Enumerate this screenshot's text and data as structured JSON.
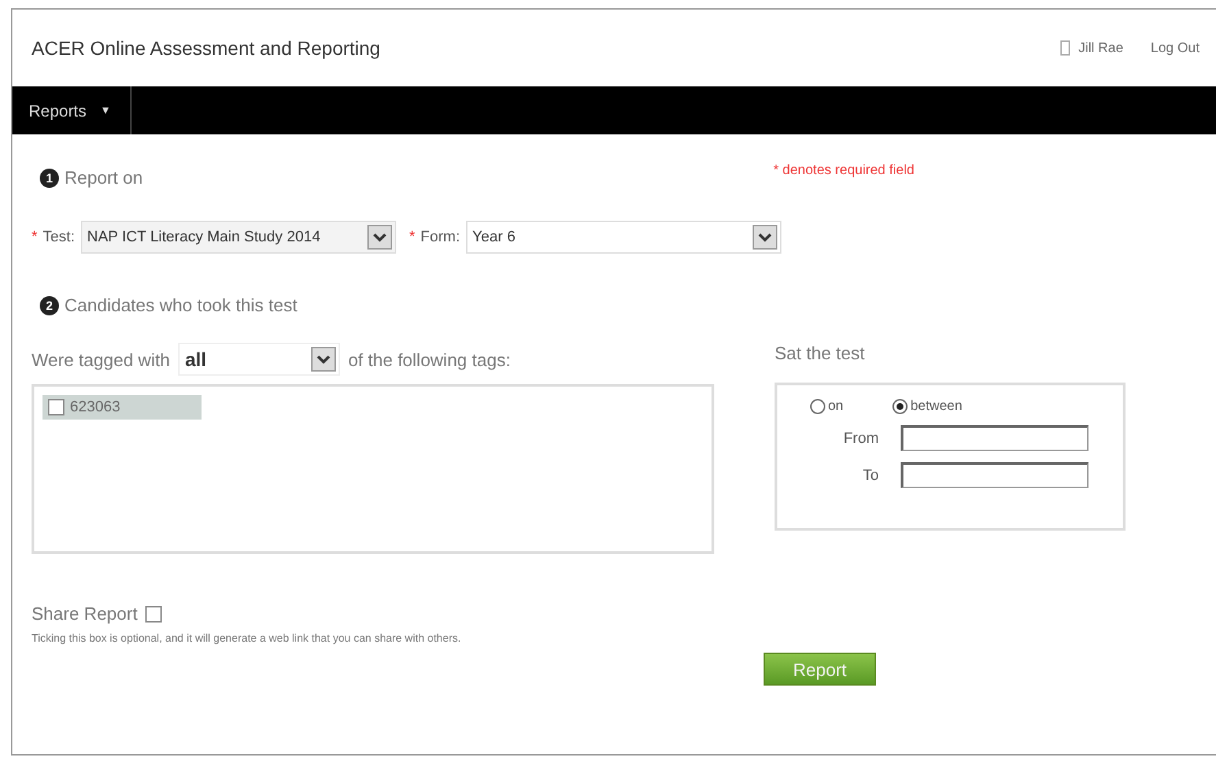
{
  "header": {
    "title": "ACER Online Assessment and Reporting",
    "user": "Jill Rae",
    "logout": "Log Out"
  },
  "nav": {
    "menu": "Reports",
    "caret": "▼"
  },
  "required_note": "* denotes required field",
  "section1": {
    "number": "1",
    "title": "Report on"
  },
  "test": {
    "required": "*",
    "label": "Test:",
    "value": "NAP ICT Literacy Main Study 2014"
  },
  "form": {
    "required": "*",
    "label": "Form:",
    "value": "Year 6"
  },
  "section2": {
    "number": "2",
    "title": "Candidates who took this test"
  },
  "tag_filter": {
    "before": "Were tagged with",
    "value": "all",
    "after": "of the following tags:"
  },
  "tags": [
    {
      "label": "623063",
      "checked": false,
      "selected": true
    }
  ],
  "sat": {
    "title": "Sat the test",
    "options": [
      {
        "label": "on",
        "selected": false
      },
      {
        "label": "between",
        "selected": true
      }
    ],
    "from_label": "From",
    "to_label": "To"
  },
  "share": {
    "label": "Share Report",
    "checked": false,
    "hint": "Ticking this box is optional, and it will generate a web link that you can share with others."
  },
  "report_button": "Report"
}
